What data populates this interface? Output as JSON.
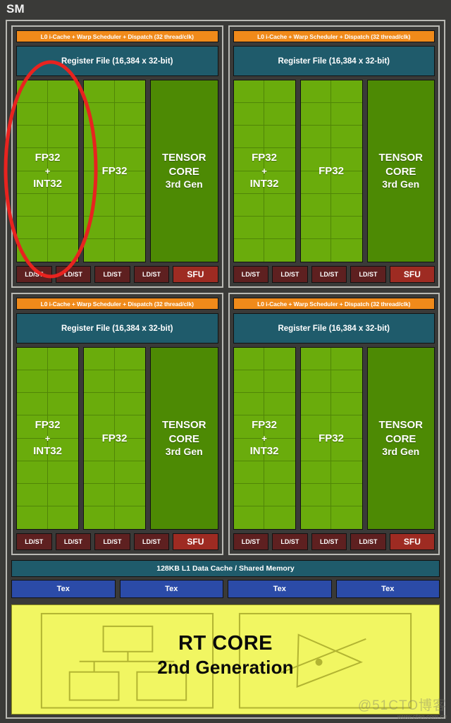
{
  "title": "SM",
  "quadrants": [
    {
      "scheduler": "L0 i-Cache + Warp Scheduler + Dispatch (32 thread/clk)",
      "register_file": "Register File (16,384 x 32-bit)",
      "fp32_int32": {
        "line1": "FP32",
        "line2": "+",
        "line3": "INT32"
      },
      "fp32": "FP32",
      "tensor": {
        "line1": "TENSOR",
        "line2": "CORE",
        "line3": "3rd Gen"
      },
      "ldst": [
        "LD/ST",
        "LD/ST",
        "LD/ST",
        "LD/ST"
      ],
      "sfu": "SFU"
    },
    {
      "scheduler": "L0 i-Cache + Warp Scheduler + Dispatch (32 thread/clk)",
      "register_file": "Register File (16,384 x 32-bit)",
      "fp32_int32": {
        "line1": "FP32",
        "line2": "+",
        "line3": "INT32"
      },
      "fp32": "FP32",
      "tensor": {
        "line1": "TENSOR",
        "line2": "CORE",
        "line3": "3rd Gen"
      },
      "ldst": [
        "LD/ST",
        "LD/ST",
        "LD/ST",
        "LD/ST"
      ],
      "sfu": "SFU"
    },
    {
      "scheduler": "L0 i-Cache + Warp Scheduler + Dispatch (32 thread/clk)",
      "register_file": "Register File (16,384 x 32-bit)",
      "fp32_int32": {
        "line1": "FP32",
        "line2": "+",
        "line3": "INT32"
      },
      "fp32": "FP32",
      "tensor": {
        "line1": "TENSOR",
        "line2": "CORE",
        "line3": "3rd Gen"
      },
      "ldst": [
        "LD/ST",
        "LD/ST",
        "LD/ST",
        "LD/ST"
      ],
      "sfu": "SFU"
    },
    {
      "scheduler": "L0 i-Cache + Warp Scheduler + Dispatch (32 thread/clk)",
      "register_file": "Register File (16,384 x 32-bit)",
      "fp32_int32": {
        "line1": "FP32",
        "line2": "+",
        "line3": "INT32"
      },
      "fp32": "FP32",
      "tensor": {
        "line1": "TENSOR",
        "line2": "CORE",
        "line3": "3rd Gen"
      },
      "ldst": [
        "LD/ST",
        "LD/ST",
        "LD/ST",
        "LD/ST"
      ],
      "sfu": "SFU"
    }
  ],
  "l1_cache": "128KB L1 Data Cache / Shared Memory",
  "tex_units": [
    "Tex",
    "Tex",
    "Tex",
    "Tex"
  ],
  "rt_core": {
    "line1": "RT CORE",
    "line2": "2nd Generation",
    "left_diagram": "bvh-tree-icon",
    "right_diagram": "ray-triangle-intersection-icon"
  },
  "annotation": {
    "shape": "ellipse",
    "color": "#e8231f",
    "target": "fp32-int32-block-quadrant-1"
  },
  "watermark": {
    "main": "@51CTO博客",
    "sub": "www.cfan.com.cn"
  },
  "colors": {
    "background": "#3a3a38",
    "frame": "#b9b9b4",
    "scheduler": "#f08a1a",
    "register_file": "#1f5b6b",
    "fp32": "#6aac0c",
    "tensor_core": "#4d8a04",
    "ldst": "#5e2020",
    "sfu": "#9e2b22",
    "l1_cache": "#1f5b6b",
    "tex": "#2b4ba8",
    "rt_core": "#f1f662"
  }
}
